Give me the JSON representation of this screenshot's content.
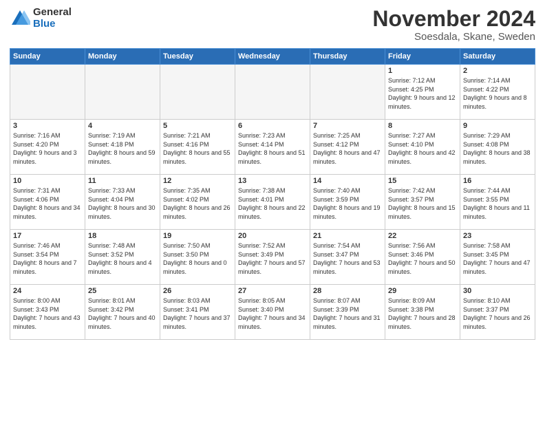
{
  "logo": {
    "general": "General",
    "blue": "Blue"
  },
  "title": "November 2024",
  "location": "Soesdala, Skane, Sweden",
  "weekdays": [
    "Sunday",
    "Monday",
    "Tuesday",
    "Wednesday",
    "Thursday",
    "Friday",
    "Saturday"
  ],
  "weeks": [
    [
      {
        "day": "",
        "empty": true
      },
      {
        "day": "",
        "empty": true
      },
      {
        "day": "",
        "empty": true
      },
      {
        "day": "",
        "empty": true
      },
      {
        "day": "",
        "empty": true
      },
      {
        "day": "1",
        "sunrise": "7:12 AM",
        "sunset": "4:25 PM",
        "daylight": "9 hours and 12 minutes."
      },
      {
        "day": "2",
        "sunrise": "7:14 AM",
        "sunset": "4:22 PM",
        "daylight": "9 hours and 8 minutes."
      }
    ],
    [
      {
        "day": "3",
        "sunrise": "7:16 AM",
        "sunset": "4:20 PM",
        "daylight": "9 hours and 3 minutes."
      },
      {
        "day": "4",
        "sunrise": "7:19 AM",
        "sunset": "4:18 PM",
        "daylight": "8 hours and 59 minutes."
      },
      {
        "day": "5",
        "sunrise": "7:21 AM",
        "sunset": "4:16 PM",
        "daylight": "8 hours and 55 minutes."
      },
      {
        "day": "6",
        "sunrise": "7:23 AM",
        "sunset": "4:14 PM",
        "daylight": "8 hours and 51 minutes."
      },
      {
        "day": "7",
        "sunrise": "7:25 AM",
        "sunset": "4:12 PM",
        "daylight": "8 hours and 47 minutes."
      },
      {
        "day": "8",
        "sunrise": "7:27 AM",
        "sunset": "4:10 PM",
        "daylight": "8 hours and 42 minutes."
      },
      {
        "day": "9",
        "sunrise": "7:29 AM",
        "sunset": "4:08 PM",
        "daylight": "8 hours and 38 minutes."
      }
    ],
    [
      {
        "day": "10",
        "sunrise": "7:31 AM",
        "sunset": "4:06 PM",
        "daylight": "8 hours and 34 minutes."
      },
      {
        "day": "11",
        "sunrise": "7:33 AM",
        "sunset": "4:04 PM",
        "daylight": "8 hours and 30 minutes."
      },
      {
        "day": "12",
        "sunrise": "7:35 AM",
        "sunset": "4:02 PM",
        "daylight": "8 hours and 26 minutes."
      },
      {
        "day": "13",
        "sunrise": "7:38 AM",
        "sunset": "4:01 PM",
        "daylight": "8 hours and 22 minutes."
      },
      {
        "day": "14",
        "sunrise": "7:40 AM",
        "sunset": "3:59 PM",
        "daylight": "8 hours and 19 minutes."
      },
      {
        "day": "15",
        "sunrise": "7:42 AM",
        "sunset": "3:57 PM",
        "daylight": "8 hours and 15 minutes."
      },
      {
        "day": "16",
        "sunrise": "7:44 AM",
        "sunset": "3:55 PM",
        "daylight": "8 hours and 11 minutes."
      }
    ],
    [
      {
        "day": "17",
        "sunrise": "7:46 AM",
        "sunset": "3:54 PM",
        "daylight": "8 hours and 7 minutes."
      },
      {
        "day": "18",
        "sunrise": "7:48 AM",
        "sunset": "3:52 PM",
        "daylight": "8 hours and 4 minutes."
      },
      {
        "day": "19",
        "sunrise": "7:50 AM",
        "sunset": "3:50 PM",
        "daylight": "8 hours and 0 minutes."
      },
      {
        "day": "20",
        "sunrise": "7:52 AM",
        "sunset": "3:49 PM",
        "daylight": "7 hours and 57 minutes."
      },
      {
        "day": "21",
        "sunrise": "7:54 AM",
        "sunset": "3:47 PM",
        "daylight": "7 hours and 53 minutes."
      },
      {
        "day": "22",
        "sunrise": "7:56 AM",
        "sunset": "3:46 PM",
        "daylight": "7 hours and 50 minutes."
      },
      {
        "day": "23",
        "sunrise": "7:58 AM",
        "sunset": "3:45 PM",
        "daylight": "7 hours and 47 minutes."
      }
    ],
    [
      {
        "day": "24",
        "sunrise": "8:00 AM",
        "sunset": "3:43 PM",
        "daylight": "7 hours and 43 minutes."
      },
      {
        "day": "25",
        "sunrise": "8:01 AM",
        "sunset": "3:42 PM",
        "daylight": "7 hours and 40 minutes."
      },
      {
        "day": "26",
        "sunrise": "8:03 AM",
        "sunset": "3:41 PM",
        "daylight": "7 hours and 37 minutes."
      },
      {
        "day": "27",
        "sunrise": "8:05 AM",
        "sunset": "3:40 PM",
        "daylight": "7 hours and 34 minutes."
      },
      {
        "day": "28",
        "sunrise": "8:07 AM",
        "sunset": "3:39 PM",
        "daylight": "7 hours and 31 minutes."
      },
      {
        "day": "29",
        "sunrise": "8:09 AM",
        "sunset": "3:38 PM",
        "daylight": "7 hours and 28 minutes."
      },
      {
        "day": "30",
        "sunrise": "8:10 AM",
        "sunset": "3:37 PM",
        "daylight": "7 hours and 26 minutes."
      }
    ]
  ],
  "labels": {
    "sunrise": "Sunrise:",
    "sunset": "Sunset:",
    "daylight": "Daylight:"
  }
}
